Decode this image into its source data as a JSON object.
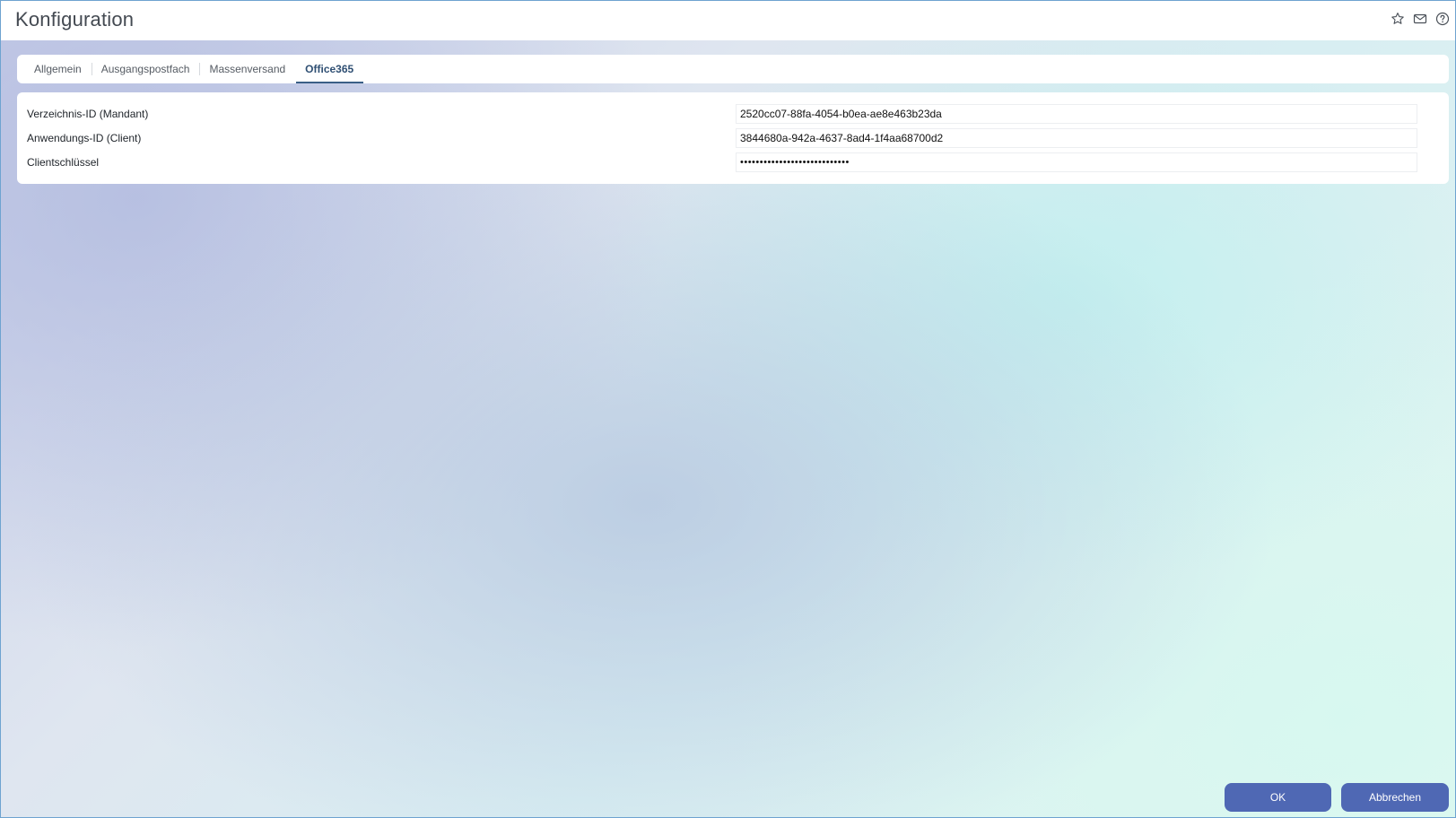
{
  "window": {
    "title": "Konfiguration"
  },
  "title_icons": [
    {
      "name": "star-icon"
    },
    {
      "name": "mail-icon"
    },
    {
      "name": "help-icon"
    }
  ],
  "tabs": [
    {
      "label": "Allgemein",
      "active": false
    },
    {
      "label": "Ausgangspostfach",
      "active": false
    },
    {
      "label": "Massenversand",
      "active": false
    },
    {
      "label": "Office365",
      "active": true
    }
  ],
  "form": {
    "fields": [
      {
        "label": "Verzeichnis-ID (Mandant)",
        "value": "2520cc07-88fa-4054-b0ea-ae8e463b23da"
      },
      {
        "label": "Anwendungs-ID (Client)",
        "value": "3844680a-942a-4637-8ad4-1f4aa68700d2"
      },
      {
        "label": "Clientschlüssel",
        "value": "••••••••••••••••••••••••••••"
      }
    ]
  },
  "buttons": {
    "ok_label": "OK",
    "cancel_label": "Abbrechen"
  },
  "colors": {
    "accent": "#4f68b4",
    "active_tab": "#3a5f86",
    "window_border": "#6ea3d0"
  }
}
